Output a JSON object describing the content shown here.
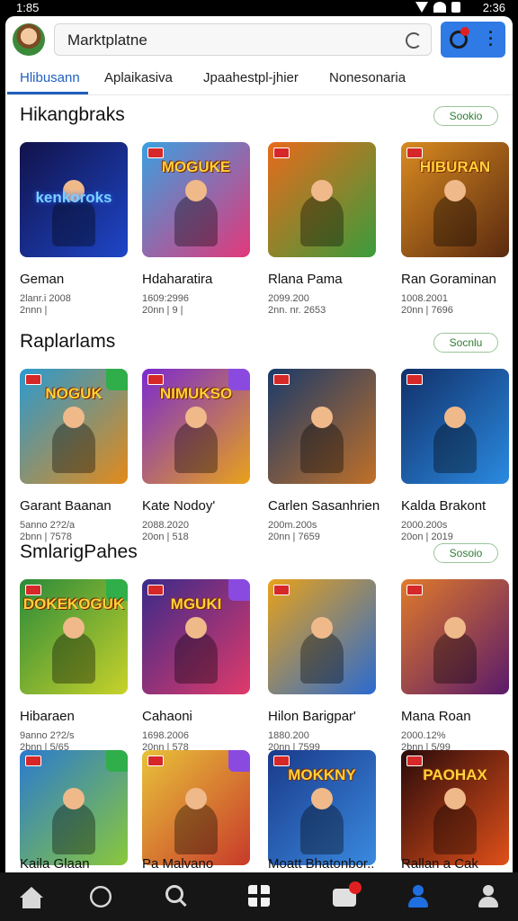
{
  "status": {
    "time_left": "1:85",
    "time_right": "2:36"
  },
  "header": {
    "search_label": "Marktplatne",
    "avatar_icon": "user-avatar",
    "refresh_icon": "refresh-icon",
    "notifications_icon": "notifications-icon",
    "more_icon": "more-vert-icon",
    "action_color": "#2f7ae5"
  },
  "tabs": [
    {
      "label": "Hlibusann",
      "active": true
    },
    {
      "label": "Aplaikasiva",
      "active": false
    },
    {
      "label": "Jpaahestpl-jhier",
      "active": false
    },
    {
      "label": "Nonesonaria",
      "active": false
    }
  ],
  "sections": [
    {
      "title": "Hikangbraks",
      "more": "Sookio",
      "cards": [
        {
          "name": "Geman",
          "meta1": "2lanr.i 2008",
          "meta2": "2nnn | ",
          "art": "kenkoroks",
          "colors": [
            "#11124a",
            "#1e46c8"
          ]
        },
        {
          "name": "Hdaharatira",
          "meta1": "1609:2996",
          "meta2": "20nn | 9 | ",
          "art": "MOGUKE",
          "colors": [
            "#3aa0e0",
            "#e2387a"
          ]
        },
        {
          "name": "Rlana Pama",
          "meta1": "2099.200",
          "meta2": "2nn. nr. 2653",
          "art": "",
          "colors": [
            "#e86a1c",
            "#3a9c3c"
          ]
        },
        {
          "name": "Ran Goraminan",
          "meta1": "1008.2001",
          "meta2": "20nn | 7696",
          "art": "HIBURAN",
          "colors": [
            "#d98a20",
            "#5a2a10"
          ]
        }
      ]
    },
    {
      "title": "Raplarlams",
      "more": "Socnlu",
      "cards": [
        {
          "name": "Garant Baanan",
          "meta1": "5anno 2?2/a",
          "meta2": "2bnn | 7578",
          "art": "NOGUK",
          "colors": [
            "#2a9ad0",
            "#e38a1a"
          ]
        },
        {
          "name": "Kate Nodoy'",
          "meta1": "2088.2020",
          "meta2": "20on | 518",
          "art": "NIMUKSO",
          "colors": [
            "#7a2ad0",
            "#e8a21a"
          ]
        },
        {
          "name": "Carlen Sasanhrien",
          "meta1": "200m.200s",
          "meta2": "20nn | 7659",
          "art": "",
          "colors": [
            "#1a3a6a",
            "#c07028"
          ]
        },
        {
          "name": "Kalda Brakont",
          "meta1": "2000.200s",
          "meta2": "20on | 2019",
          "art": "",
          "colors": [
            "#12306a",
            "#2a8ae0"
          ]
        }
      ]
    },
    {
      "title": "SmlarigPahes",
      "more": "Sosoio",
      "cards": [
        {
          "name": "Hibaraen",
          "meta1": "9anno 2?2/s",
          "meta2": "2bnn | 5/65",
          "art": "DOKEKOGUK",
          "colors": [
            "#2a8a3a",
            "#c8d22a"
          ]
        },
        {
          "name": "Cahaoni",
          "meta1": "1698.2006",
          "meta2": "20nn | 578",
          "art": "MGUKI",
          "colors": [
            "#3a2a8a",
            "#e03a6a"
          ]
        },
        {
          "name": "Hilon Barigpar'",
          "meta1": "1880.200",
          "meta2": "20nn | 7599",
          "art": "",
          "colors": [
            "#e8a21a",
            "#2a6ad0"
          ]
        },
        {
          "name": "Mana Roan",
          "meta1": "2000.12%",
          "meta2": "2bnn | 5/99",
          "art": "",
          "colors": [
            "#e07a2a",
            "#5a1a6a"
          ]
        }
      ]
    },
    {
      "title": "",
      "more": "",
      "cards": [
        {
          "name": "Kaila Glaan",
          "meta1": "",
          "meta2": "",
          "art": "",
          "colors": [
            "#2a7ad0",
            "#8ac83a"
          ]
        },
        {
          "name": "Pa Malvano",
          "meta1": "",
          "meta2": "",
          "art": "",
          "colors": [
            "#e8c23a",
            "#c83a2a"
          ]
        },
        {
          "name": "Moatt Bhatonbor..",
          "meta1": "",
          "meta2": "",
          "art": "MOKKNY",
          "colors": [
            "#1a3a8a",
            "#3a8ae0"
          ]
        },
        {
          "name": "Rallan a Cak",
          "meta1": "",
          "meta2": "",
          "art": "PAOHAX",
          "colors": [
            "#2a0a0a",
            "#e0501a"
          ]
        }
      ]
    }
  ],
  "navbar": {
    "items": [
      "home-icon",
      "apps-icon",
      "search-icon",
      "add-icon",
      "inbox-icon",
      "account-icon",
      "profile-icon"
    ],
    "active_color": "#1f6fe0"
  }
}
